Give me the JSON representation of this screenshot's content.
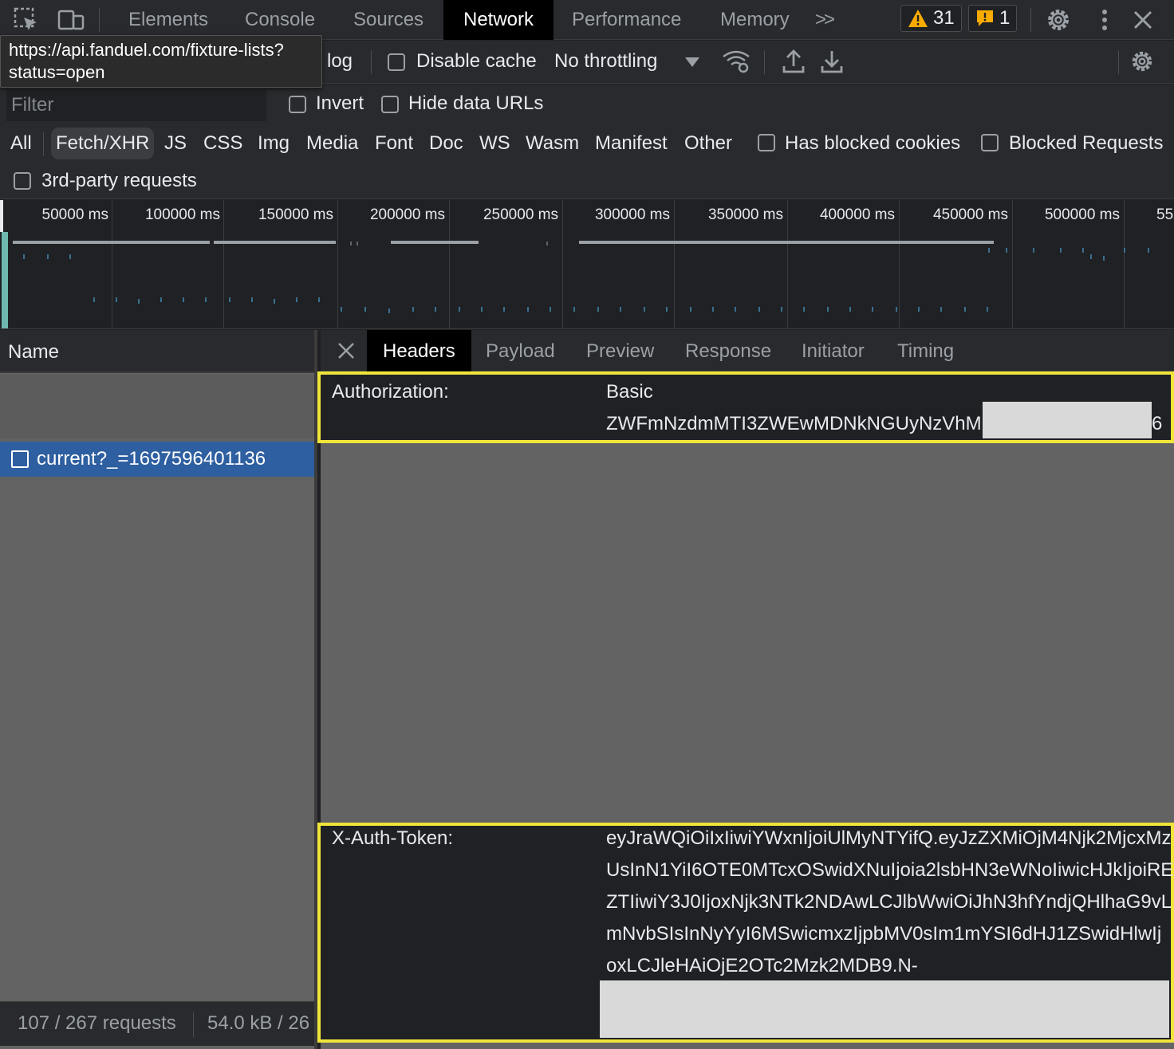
{
  "tabs": [
    "Elements",
    "Console",
    "Sources",
    "Network",
    "Performance",
    "Memory"
  ],
  "active_tab": "Network",
  "more_tabs_glyph": ">>",
  "badges": {
    "warnings": "31",
    "issues": "1"
  },
  "tooltip": {
    "line1": "https://api.fanduel.com/fixture-lists?",
    "line2": "status=open"
  },
  "toolbar": {
    "preserve_log_fragment": "log",
    "disable_cache": "Disable cache",
    "throttling": "No throttling"
  },
  "filter": {
    "placeholder": "Filter",
    "invert": "Invert",
    "hide_data_urls": "Hide data URLs",
    "types": [
      "All",
      "Fetch/XHR",
      "JS",
      "CSS",
      "Img",
      "Media",
      "Font",
      "Doc",
      "WS",
      "Wasm",
      "Manifest",
      "Other"
    ],
    "selected_type": "Fetch/XHR",
    "has_blocked_cookies": "Has blocked cookies",
    "blocked_requests": "Blocked Requests",
    "third_party": "3rd-party requests"
  },
  "overview": {
    "ticks": [
      "50000 ms",
      "100000 ms",
      "150000 ms",
      "200000 ms",
      "250000 ms",
      "300000 ms",
      "350000 ms",
      "400000 ms",
      "450000 ms",
      "500000 ms",
      "55"
    ]
  },
  "request_list": {
    "column": "Name",
    "selected_request": "current?_=1697596401136",
    "status_requests": "107 / 267 requests",
    "status_size": "54.0 kB / 26"
  },
  "details": {
    "tabs": [
      "Headers",
      "Payload",
      "Preview",
      "Response",
      "Initiator",
      "Timing"
    ],
    "active_tab": "Headers",
    "authorization": {
      "name": "Authorization:",
      "line1": "Basic",
      "line2": "ZWFmNzdmMTI3ZWEwMDNkNGUyNzVhM",
      "tail": "6"
    },
    "x_auth_token": {
      "name": "X-Auth-Token:",
      "lines": [
        "eyJraWQiOiIxIiwiYWxnIjoiUlMyNTYifQ.eyJzZXMiOjM4Njk2MjcxMz",
        "UsInN1YiI6OTE0MTcxOSwidXNuIjoia2lsbHN3eWNoIiwicHJkIjoiRE",
        "ZTIiwiY3J0IjoxNjk3NTk2NDAwLCJlbWwiOiJhN3hfYndjQHlhaG9vL",
        "mNvbSIsInNyYyI6MSwicmxzIjpbMV0sIm1mYSI6dHJ1ZSwidHlwIj",
        "oxLCJleHAiOjE2OTc2Mzk2MDB9.N-"
      ]
    }
  },
  "colors": {
    "highlight": "#f0e53a",
    "selected_row": "#2e5fa0",
    "warning": "#f9ab00",
    "issue": "#f9ab00"
  }
}
